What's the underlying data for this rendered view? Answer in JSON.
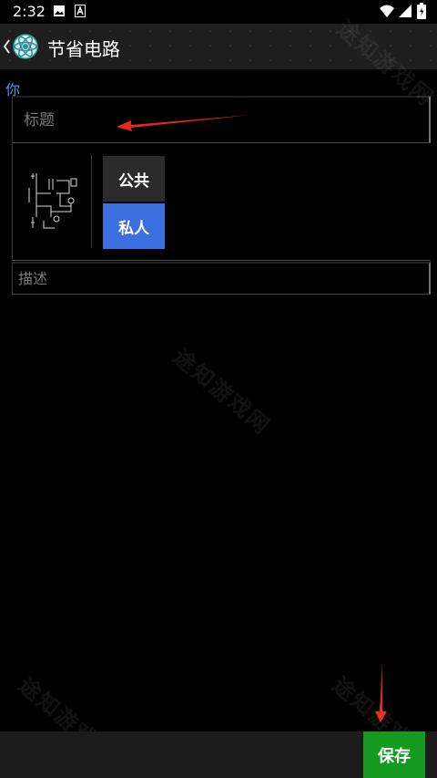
{
  "status_bar": {
    "time": "2:32",
    "icons": [
      "image-icon",
      "notification-a-icon",
      "wifi-icon",
      "signal-icon",
      "battery-icon"
    ]
  },
  "action_bar": {
    "back_icon": "chevron-left-icon",
    "logo_icon": "app-logo-icon",
    "title": "节省电路"
  },
  "form": {
    "section_label": "你",
    "title_placeholder": "标题",
    "visibility": {
      "options": [
        "公共",
        "私人"
      ],
      "selected": "私人"
    },
    "description_placeholder": "描述"
  },
  "bottom_bar": {
    "save_label": "保存"
  },
  "watermark_text": "途知游戏网",
  "colors": {
    "accent_blue": "#3b6fe0",
    "label_blue": "#5c8ef0",
    "save_green": "#149b1f",
    "annotation_red": "#e8261b",
    "background": "#000000"
  }
}
